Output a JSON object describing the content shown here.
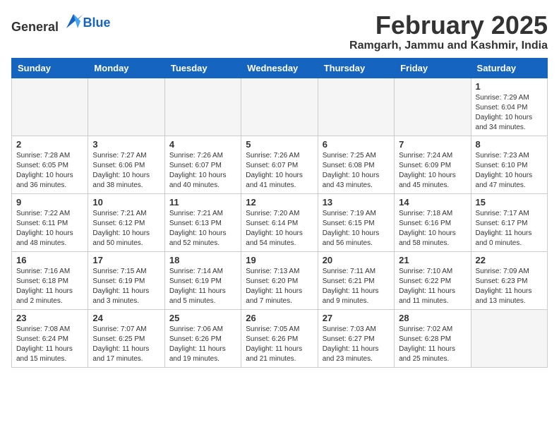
{
  "header": {
    "logo_general": "General",
    "logo_blue": "Blue",
    "month_title": "February 2025",
    "location": "Ramgarh, Jammu and Kashmir, India"
  },
  "weekdays": [
    "Sunday",
    "Monday",
    "Tuesday",
    "Wednesday",
    "Thursday",
    "Friday",
    "Saturday"
  ],
  "weeks": [
    [
      {
        "day": "",
        "empty": true
      },
      {
        "day": "",
        "empty": true
      },
      {
        "day": "",
        "empty": true
      },
      {
        "day": "",
        "empty": true
      },
      {
        "day": "",
        "empty": true
      },
      {
        "day": "",
        "empty": true
      },
      {
        "day": "1",
        "sunrise": "7:29 AM",
        "sunset": "6:04 PM",
        "daylight": "10 hours and 34 minutes."
      }
    ],
    [
      {
        "day": "2",
        "sunrise": "7:28 AM",
        "sunset": "6:05 PM",
        "daylight": "10 hours and 36 minutes."
      },
      {
        "day": "3",
        "sunrise": "7:27 AM",
        "sunset": "6:06 PM",
        "daylight": "10 hours and 38 minutes."
      },
      {
        "day": "4",
        "sunrise": "7:26 AM",
        "sunset": "6:07 PM",
        "daylight": "10 hours and 40 minutes."
      },
      {
        "day": "5",
        "sunrise": "7:26 AM",
        "sunset": "6:07 PM",
        "daylight": "10 hours and 41 minutes."
      },
      {
        "day": "6",
        "sunrise": "7:25 AM",
        "sunset": "6:08 PM",
        "daylight": "10 hours and 43 minutes."
      },
      {
        "day": "7",
        "sunrise": "7:24 AM",
        "sunset": "6:09 PM",
        "daylight": "10 hours and 45 minutes."
      },
      {
        "day": "8",
        "sunrise": "7:23 AM",
        "sunset": "6:10 PM",
        "daylight": "10 hours and 47 minutes."
      }
    ],
    [
      {
        "day": "9",
        "sunrise": "7:22 AM",
        "sunset": "6:11 PM",
        "daylight": "10 hours and 48 minutes."
      },
      {
        "day": "10",
        "sunrise": "7:21 AM",
        "sunset": "6:12 PM",
        "daylight": "10 hours and 50 minutes."
      },
      {
        "day": "11",
        "sunrise": "7:21 AM",
        "sunset": "6:13 PM",
        "daylight": "10 hours and 52 minutes."
      },
      {
        "day": "12",
        "sunrise": "7:20 AM",
        "sunset": "6:14 PM",
        "daylight": "10 hours and 54 minutes."
      },
      {
        "day": "13",
        "sunrise": "7:19 AM",
        "sunset": "6:15 PM",
        "daylight": "10 hours and 56 minutes."
      },
      {
        "day": "14",
        "sunrise": "7:18 AM",
        "sunset": "6:16 PM",
        "daylight": "10 hours and 58 minutes."
      },
      {
        "day": "15",
        "sunrise": "7:17 AM",
        "sunset": "6:17 PM",
        "daylight": "11 hours and 0 minutes."
      }
    ],
    [
      {
        "day": "16",
        "sunrise": "7:16 AM",
        "sunset": "6:18 PM",
        "daylight": "11 hours and 2 minutes."
      },
      {
        "day": "17",
        "sunrise": "7:15 AM",
        "sunset": "6:19 PM",
        "daylight": "11 hours and 3 minutes."
      },
      {
        "day": "18",
        "sunrise": "7:14 AM",
        "sunset": "6:19 PM",
        "daylight": "11 hours and 5 minutes."
      },
      {
        "day": "19",
        "sunrise": "7:13 AM",
        "sunset": "6:20 PM",
        "daylight": "11 hours and 7 minutes."
      },
      {
        "day": "20",
        "sunrise": "7:11 AM",
        "sunset": "6:21 PM",
        "daylight": "11 hours and 9 minutes."
      },
      {
        "day": "21",
        "sunrise": "7:10 AM",
        "sunset": "6:22 PM",
        "daylight": "11 hours and 11 minutes."
      },
      {
        "day": "22",
        "sunrise": "7:09 AM",
        "sunset": "6:23 PM",
        "daylight": "11 hours and 13 minutes."
      }
    ],
    [
      {
        "day": "23",
        "sunrise": "7:08 AM",
        "sunset": "6:24 PM",
        "daylight": "11 hours and 15 minutes."
      },
      {
        "day": "24",
        "sunrise": "7:07 AM",
        "sunset": "6:25 PM",
        "daylight": "11 hours and 17 minutes."
      },
      {
        "day": "25",
        "sunrise": "7:06 AM",
        "sunset": "6:26 PM",
        "daylight": "11 hours and 19 minutes."
      },
      {
        "day": "26",
        "sunrise": "7:05 AM",
        "sunset": "6:26 PM",
        "daylight": "11 hours and 21 minutes."
      },
      {
        "day": "27",
        "sunrise": "7:03 AM",
        "sunset": "6:27 PM",
        "daylight": "11 hours and 23 minutes."
      },
      {
        "day": "28",
        "sunrise": "7:02 AM",
        "sunset": "6:28 PM",
        "daylight": "11 hours and 25 minutes."
      },
      {
        "day": "",
        "empty": true
      }
    ]
  ]
}
